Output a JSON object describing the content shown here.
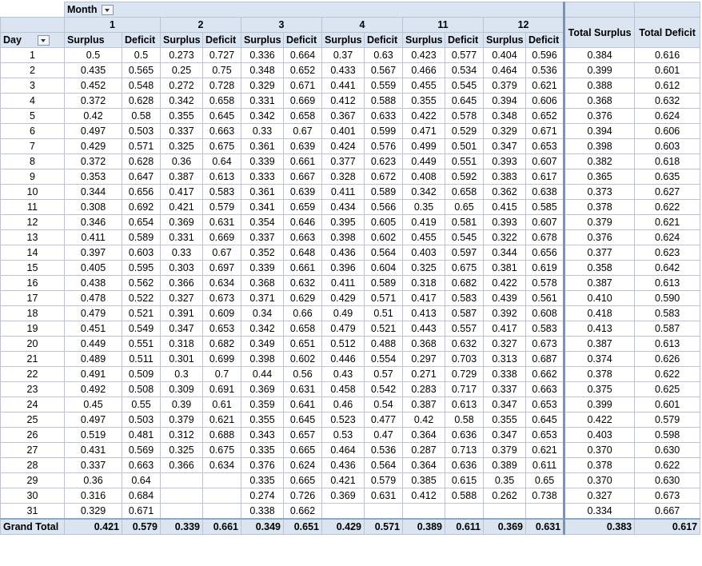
{
  "pivot": {
    "column_field": "Month",
    "row_field": "Day",
    "sub_headers": {
      "surplus": "Surplus",
      "deficit": "Deficit"
    },
    "months": [
      "1",
      "2",
      "3",
      "4",
      "11",
      "12"
    ],
    "total_surplus_label": "Total Surplus",
    "total_deficit_label": "Total Deficit",
    "rows": [
      {
        "day": "1",
        "cells": [
          "0.5",
          "0.5",
          "0.273",
          "0.727",
          "0.336",
          "0.664",
          "0.37",
          "0.63",
          "0.423",
          "0.577",
          "0.404",
          "0.596"
        ],
        "ts": "0.384",
        "td": "0.616"
      },
      {
        "day": "2",
        "cells": [
          "0.435",
          "0.565",
          "0.25",
          "0.75",
          "0.348",
          "0.652",
          "0.433",
          "0.567",
          "0.466",
          "0.534",
          "0.464",
          "0.536"
        ],
        "ts": "0.399",
        "td": "0.601"
      },
      {
        "day": "3",
        "cells": [
          "0.452",
          "0.548",
          "0.272",
          "0.728",
          "0.329",
          "0.671",
          "0.441",
          "0.559",
          "0.455",
          "0.545",
          "0.379",
          "0.621"
        ],
        "ts": "0.388",
        "td": "0.612"
      },
      {
        "day": "4",
        "cells": [
          "0.372",
          "0.628",
          "0.342",
          "0.658",
          "0.331",
          "0.669",
          "0.412",
          "0.588",
          "0.355",
          "0.645",
          "0.394",
          "0.606"
        ],
        "ts": "0.368",
        "td": "0.632"
      },
      {
        "day": "5",
        "cells": [
          "0.42",
          "0.58",
          "0.355",
          "0.645",
          "0.342",
          "0.658",
          "0.367",
          "0.633",
          "0.422",
          "0.578",
          "0.348",
          "0.652"
        ],
        "ts": "0.376",
        "td": "0.624"
      },
      {
        "day": "6",
        "cells": [
          "0.497",
          "0.503",
          "0.337",
          "0.663",
          "0.33",
          "0.67",
          "0.401",
          "0.599",
          "0.471",
          "0.529",
          "0.329",
          "0.671"
        ],
        "ts": "0.394",
        "td": "0.606"
      },
      {
        "day": "7",
        "cells": [
          "0.429",
          "0.571",
          "0.325",
          "0.675",
          "0.361",
          "0.639",
          "0.424",
          "0.576",
          "0.499",
          "0.501",
          "0.347",
          "0.653"
        ],
        "ts": "0.398",
        "td": "0.603"
      },
      {
        "day": "8",
        "cells": [
          "0.372",
          "0.628",
          "0.36",
          "0.64",
          "0.339",
          "0.661",
          "0.377",
          "0.623",
          "0.449",
          "0.551",
          "0.393",
          "0.607"
        ],
        "ts": "0.382",
        "td": "0.618"
      },
      {
        "day": "9",
        "cells": [
          "0.353",
          "0.647",
          "0.387",
          "0.613",
          "0.333",
          "0.667",
          "0.328",
          "0.672",
          "0.408",
          "0.592",
          "0.383",
          "0.617"
        ],
        "ts": "0.365",
        "td": "0.635"
      },
      {
        "day": "10",
        "cells": [
          "0.344",
          "0.656",
          "0.417",
          "0.583",
          "0.361",
          "0.639",
          "0.411",
          "0.589",
          "0.342",
          "0.658",
          "0.362",
          "0.638"
        ],
        "ts": "0.373",
        "td": "0.627"
      },
      {
        "day": "11",
        "cells": [
          "0.308",
          "0.692",
          "0.421",
          "0.579",
          "0.341",
          "0.659",
          "0.434",
          "0.566",
          "0.35",
          "0.65",
          "0.415",
          "0.585"
        ],
        "ts": "0.378",
        "td": "0.622"
      },
      {
        "day": "12",
        "cells": [
          "0.346",
          "0.654",
          "0.369",
          "0.631",
          "0.354",
          "0.646",
          "0.395",
          "0.605",
          "0.419",
          "0.581",
          "0.393",
          "0.607"
        ],
        "ts": "0.379",
        "td": "0.621"
      },
      {
        "day": "13",
        "cells": [
          "0.411",
          "0.589",
          "0.331",
          "0.669",
          "0.337",
          "0.663",
          "0.398",
          "0.602",
          "0.455",
          "0.545",
          "0.322",
          "0.678"
        ],
        "ts": "0.376",
        "td": "0.624"
      },
      {
        "day": "14",
        "cells": [
          "0.397",
          "0.603",
          "0.33",
          "0.67",
          "0.352",
          "0.648",
          "0.436",
          "0.564",
          "0.403",
          "0.597",
          "0.344",
          "0.656"
        ],
        "ts": "0.377",
        "td": "0.623"
      },
      {
        "day": "15",
        "cells": [
          "0.405",
          "0.595",
          "0.303",
          "0.697",
          "0.339",
          "0.661",
          "0.396",
          "0.604",
          "0.325",
          "0.675",
          "0.381",
          "0.619"
        ],
        "ts": "0.358",
        "td": "0.642"
      },
      {
        "day": "16",
        "cells": [
          "0.438",
          "0.562",
          "0.366",
          "0.634",
          "0.368",
          "0.632",
          "0.411",
          "0.589",
          "0.318",
          "0.682",
          "0.422",
          "0.578"
        ],
        "ts": "0.387",
        "td": "0.613"
      },
      {
        "day": "17",
        "cells": [
          "0.478",
          "0.522",
          "0.327",
          "0.673",
          "0.371",
          "0.629",
          "0.429",
          "0.571",
          "0.417",
          "0.583",
          "0.439",
          "0.561"
        ],
        "ts": "0.410",
        "td": "0.590"
      },
      {
        "day": "18",
        "cells": [
          "0.479",
          "0.521",
          "0.391",
          "0.609",
          "0.34",
          "0.66",
          "0.49",
          "0.51",
          "0.413",
          "0.587",
          "0.392",
          "0.608"
        ],
        "ts": "0.418",
        "td": "0.583"
      },
      {
        "day": "19",
        "cells": [
          "0.451",
          "0.549",
          "0.347",
          "0.653",
          "0.342",
          "0.658",
          "0.479",
          "0.521",
          "0.443",
          "0.557",
          "0.417",
          "0.583"
        ],
        "ts": "0.413",
        "td": "0.587"
      },
      {
        "day": "20",
        "cells": [
          "0.449",
          "0.551",
          "0.318",
          "0.682",
          "0.349",
          "0.651",
          "0.512",
          "0.488",
          "0.368",
          "0.632",
          "0.327",
          "0.673"
        ],
        "ts": "0.387",
        "td": "0.613"
      },
      {
        "day": "21",
        "cells": [
          "0.489",
          "0.511",
          "0.301",
          "0.699",
          "0.398",
          "0.602",
          "0.446",
          "0.554",
          "0.297",
          "0.703",
          "0.313",
          "0.687"
        ],
        "ts": "0.374",
        "td": "0.626"
      },
      {
        "day": "22",
        "cells": [
          "0.491",
          "0.509",
          "0.3",
          "0.7",
          "0.44",
          "0.56",
          "0.43",
          "0.57",
          "0.271",
          "0.729",
          "0.338",
          "0.662"
        ],
        "ts": "0.378",
        "td": "0.622"
      },
      {
        "day": "23",
        "cells": [
          "0.492",
          "0.508",
          "0.309",
          "0.691",
          "0.369",
          "0.631",
          "0.458",
          "0.542",
          "0.283",
          "0.717",
          "0.337",
          "0.663"
        ],
        "ts": "0.375",
        "td": "0.625"
      },
      {
        "day": "24",
        "cells": [
          "0.45",
          "0.55",
          "0.39",
          "0.61",
          "0.359",
          "0.641",
          "0.46",
          "0.54",
          "0.387",
          "0.613",
          "0.347",
          "0.653"
        ],
        "ts": "0.399",
        "td": "0.601"
      },
      {
        "day": "25",
        "cells": [
          "0.497",
          "0.503",
          "0.379",
          "0.621",
          "0.355",
          "0.645",
          "0.523",
          "0.477",
          "0.42",
          "0.58",
          "0.355",
          "0.645"
        ],
        "ts": "0.422",
        "td": "0.579"
      },
      {
        "day": "26",
        "cells": [
          "0.519",
          "0.481",
          "0.312",
          "0.688",
          "0.343",
          "0.657",
          "0.53",
          "0.47",
          "0.364",
          "0.636",
          "0.347",
          "0.653"
        ],
        "ts": "0.403",
        "td": "0.598"
      },
      {
        "day": "27",
        "cells": [
          "0.431",
          "0.569",
          "0.325",
          "0.675",
          "0.335",
          "0.665",
          "0.464",
          "0.536",
          "0.287",
          "0.713",
          "0.379",
          "0.621"
        ],
        "ts": "0.370",
        "td": "0.630"
      },
      {
        "day": "28",
        "cells": [
          "0.337",
          "0.663",
          "0.366",
          "0.634",
          "0.376",
          "0.624",
          "0.436",
          "0.564",
          "0.364",
          "0.636",
          "0.389",
          "0.611"
        ],
        "ts": "0.378",
        "td": "0.622"
      },
      {
        "day": "29",
        "cells": [
          "0.36",
          "0.64",
          "",
          "",
          "0.335",
          "0.665",
          "0.421",
          "0.579",
          "0.385",
          "0.615",
          "0.35",
          "0.65"
        ],
        "ts": "0.370",
        "td": "0.630"
      },
      {
        "day": "30",
        "cells": [
          "0.316",
          "0.684",
          "",
          "",
          "0.274",
          "0.726",
          "0.369",
          "0.631",
          "0.412",
          "0.588",
          "0.262",
          "0.738"
        ],
        "ts": "0.327",
        "td": "0.673"
      },
      {
        "day": "31",
        "cells": [
          "0.329",
          "0.671",
          "",
          "",
          "0.338",
          "0.662",
          "",
          "",
          "",
          "",
          "",
          ""
        ],
        "ts": "0.334",
        "td": "0.667"
      }
    ],
    "grand": {
      "label": "Grand Total",
      "cells": [
        "0.421",
        "0.579",
        "0.339",
        "0.661",
        "0.349",
        "0.651",
        "0.429",
        "0.571",
        "0.389",
        "0.611",
        "0.369",
        "0.631"
      ],
      "ts": "0.383",
      "td": "0.617"
    }
  }
}
